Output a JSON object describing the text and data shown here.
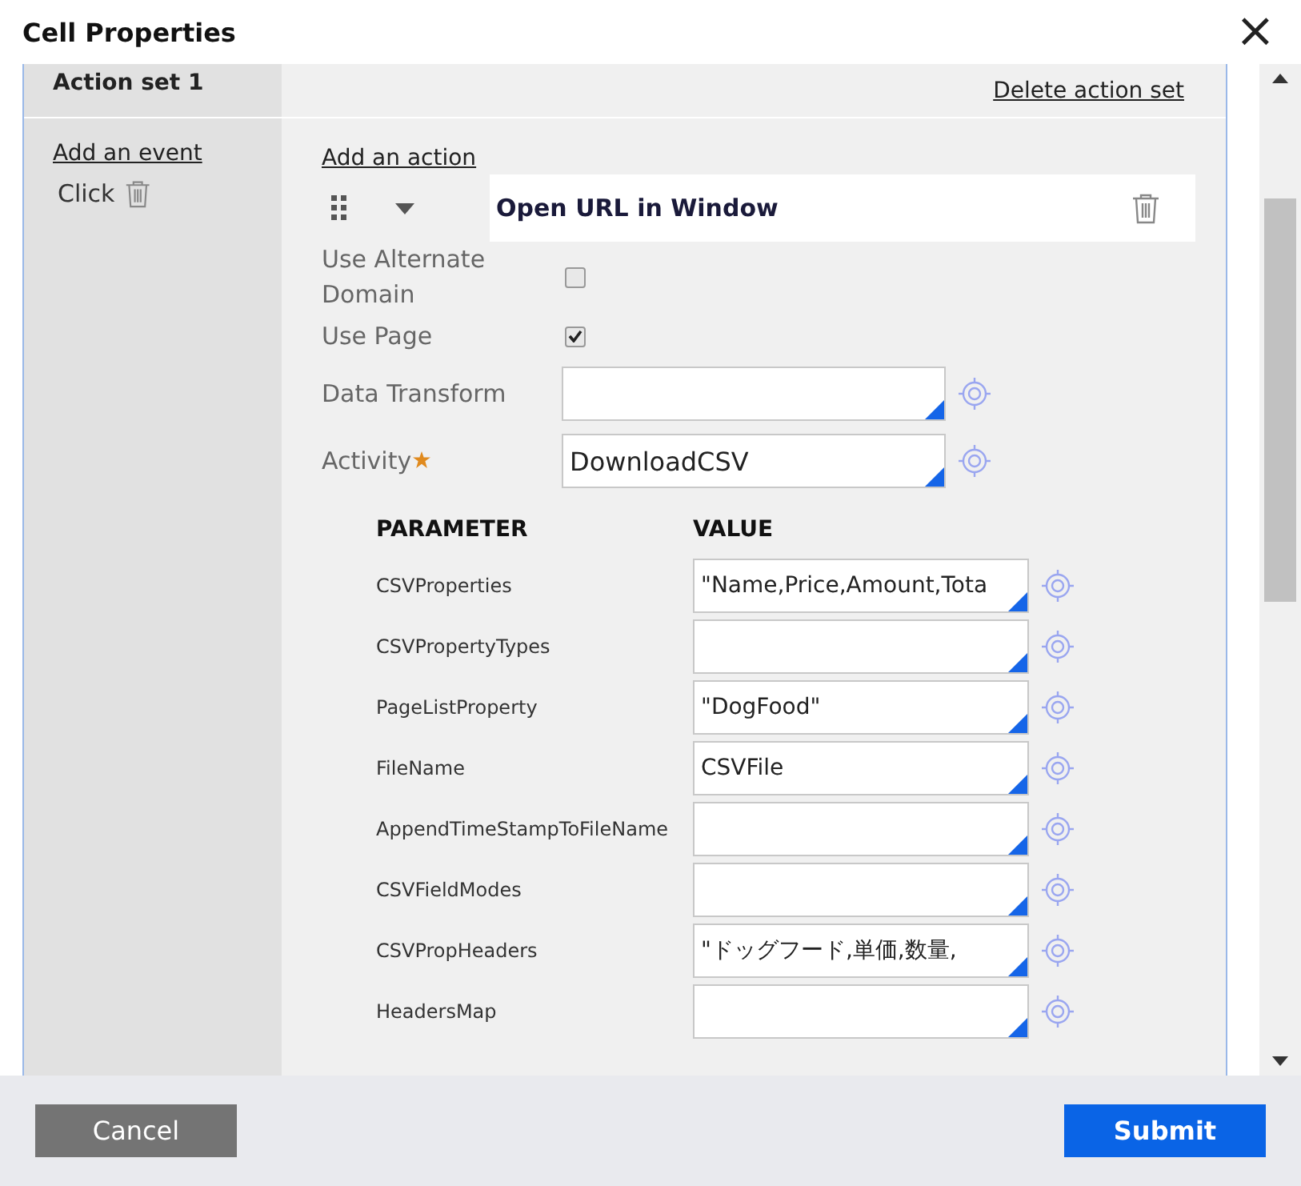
{
  "dialog": {
    "title": "Cell Properties",
    "close": "×"
  },
  "action_set": {
    "title": "Action set 1",
    "delete_link": "Delete action set"
  },
  "events": {
    "add_link": "Add an event",
    "items": [
      {
        "label": "Click"
      }
    ]
  },
  "actions": {
    "add_link": "Add an action",
    "action": {
      "title": "Open URL in Window"
    }
  },
  "settings": [
    {
      "kind": "checkbox",
      "label": "Use Alternate Domain",
      "checked": false
    },
    {
      "kind": "checkbox",
      "label": "Use Page",
      "checked": true
    },
    {
      "kind": "field",
      "label": "Data Transform",
      "required": false
    },
    {
      "kind": "field",
      "label": "Activity",
      "value": "DownloadCSV",
      "required": true
    }
  ],
  "parameters": {
    "columns": [
      "PARAMETER",
      "VALUE"
    ],
    "rows": [
      {
        "name": "CSVProperties",
        "value": "\"Name,Price,Amount,Tota"
      },
      {
        "name": "CSVPropertyTypes"
      },
      {
        "name": "PageListProperty",
        "value": "\"DogFood\""
      },
      {
        "name": "FileName",
        "value": "CSVFile"
      },
      {
        "name": "AppendTimeStampToFileName"
      },
      {
        "name": "CSVFieldModes"
      },
      {
        "name": "CSVPropHeaders",
        "value": "\"ドッグフード,単価,数量,"
      },
      {
        "name": "HeadersMap"
      }
    ]
  },
  "buttons": {
    "cancel": "Cancel",
    "submit": "Submit"
  }
}
